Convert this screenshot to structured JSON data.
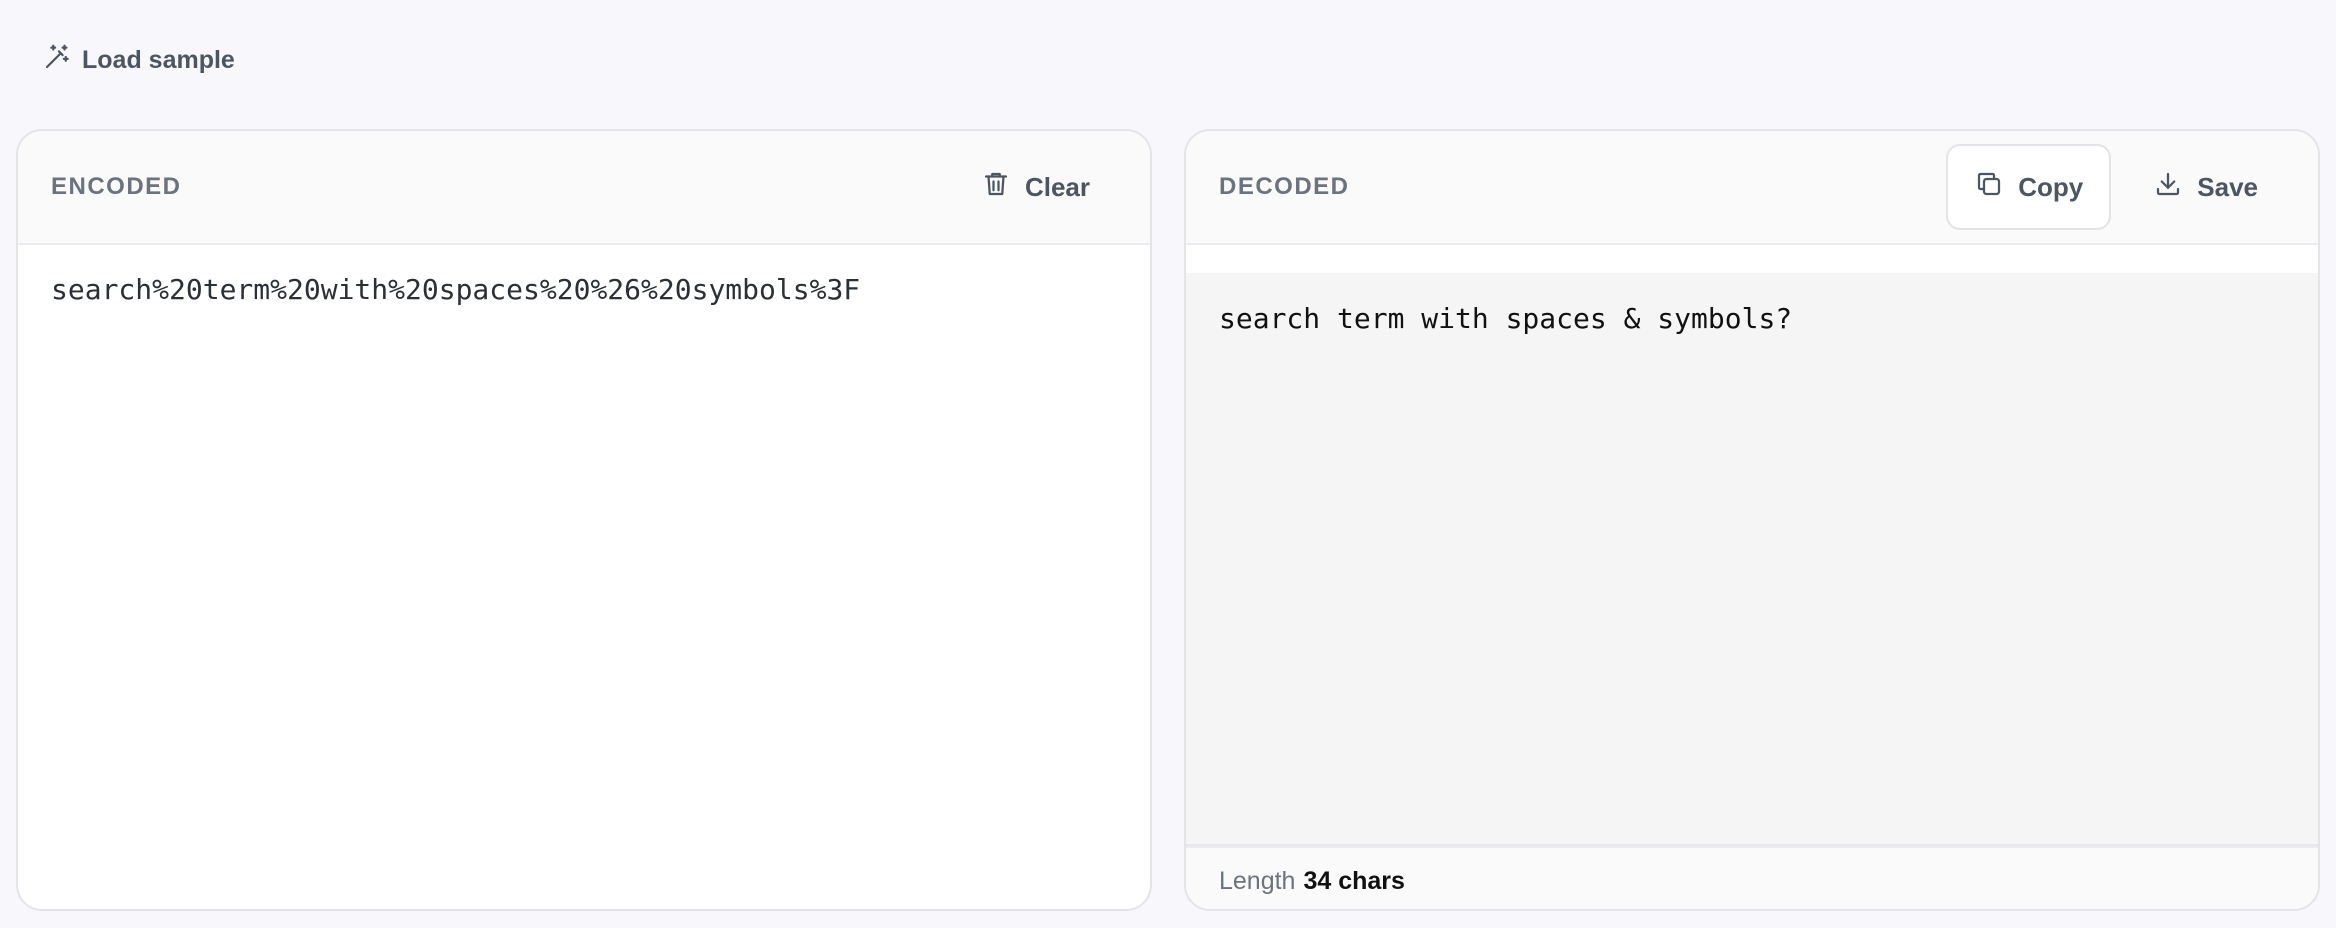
{
  "toolbar": {
    "load_sample_label": "Load sample",
    "load_sample_icon": "magic-wand-icon"
  },
  "encoded_panel": {
    "title": "ENCODED",
    "clear_label": "Clear",
    "clear_icon": "trash-icon",
    "value": "search%20term%20with%20spaces%20%26%20symbols%3F"
  },
  "decoded_panel": {
    "title": "DECODED",
    "copy_label": "Copy",
    "copy_icon": "copy-icon",
    "save_label": "Save",
    "save_icon": "download-icon",
    "value": "search term with spaces & symbols?",
    "status": {
      "length_label": "Length",
      "length_value": "34 chars"
    }
  },
  "colors": {
    "page_background": "#f8f7fc",
    "panel_border": "#e3e3e8",
    "output_background": "#f5f5f5",
    "muted_text": "#6b7280"
  }
}
